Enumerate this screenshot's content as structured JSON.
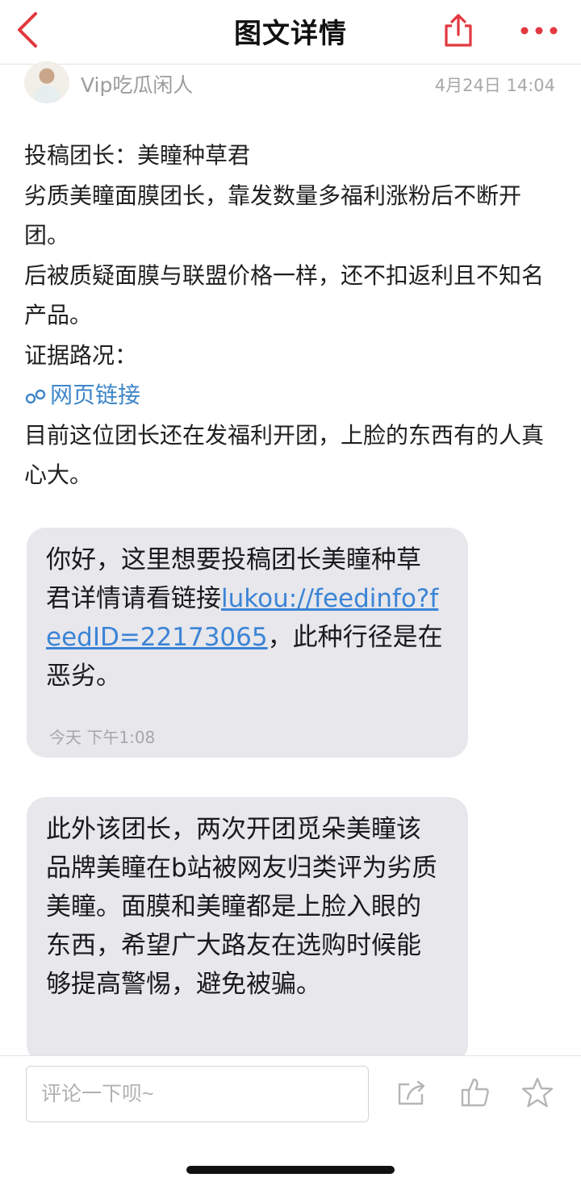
{
  "nav": {
    "title": "图文详情"
  },
  "author": {
    "name": "Vip吃瓜闲人",
    "time": "4月24日 14:04"
  },
  "post": {
    "lines": [
      "投稿团长：美瞳种草君",
      "劣质美瞳面膜团长，靠发数量多福利涨粉后不断开团。",
      "后被质疑面膜与联盟价格一样，还不扣返利且不知名产品。",
      "证据路况："
    ],
    "link_label": "网页链接",
    "closing": "目前这位团长还在发福利开团，上脸的东西有的人真心大。"
  },
  "message1": {
    "text_before": "你好，这里想要投稿团长美瞳种草君详情请看链接",
    "link": "lukou://feedinfo?feedID=22173065",
    "text_after": "，此种行径是在恶劣。",
    "time": "今天 下午1:08"
  },
  "message2": {
    "text": "此外该团长，两次开团觅朵美瞳该品牌美瞳在b站被网友归类评为劣质美瞳。面膜和美瞳都是上脸入眼的东西，希望广大路友在选购时候能够提高警惕，避免被骗。"
  },
  "bottom": {
    "comment_placeholder": "评论一下呗~"
  },
  "colors": {
    "accent": "#e2383f",
    "link": "#3f86c8",
    "bubble": "#e7e7ec"
  },
  "icons": [
    "back-arrow-icon",
    "share-icon",
    "more-icon",
    "forward-icon",
    "like-icon",
    "favorite-icon"
  ]
}
